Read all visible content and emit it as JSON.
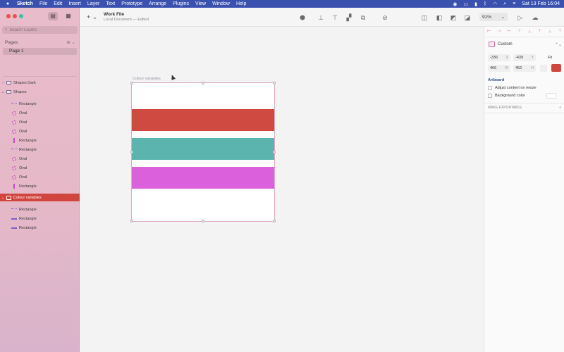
{
  "menubar": {
    "apple_icon": "apple-icon",
    "items": [
      "Sketch",
      "File",
      "Edit",
      "Insert",
      "Layer",
      "Text",
      "Prototype",
      "Arrange",
      "Plugins",
      "View",
      "Window",
      "Help"
    ],
    "datetime": "Sat 13 Feb  16:04",
    "status_icons": [
      "record-icon",
      "display-icon",
      "battery-icon",
      "bluetooth-icon",
      "wifi-icon",
      "search-icon",
      "control-center-icon"
    ]
  },
  "sidebar": {
    "search_placeholder": "Search Layers",
    "pages_label": "Pages",
    "pages": [
      {
        "label": "Page 1"
      }
    ],
    "layers": [
      {
        "label": "Shapes Dark",
        "kind": "group",
        "indent": 0
      },
      {
        "label": "Shapes",
        "kind": "group",
        "indent": 0
      },
      {
        "label": "Rectangle",
        "kind": "rect-d",
        "indent": 1
      },
      {
        "label": "Oval",
        "kind": "oval",
        "indent": 1
      },
      {
        "label": "Oval",
        "kind": "oval",
        "indent": 1
      },
      {
        "label": "Oval",
        "kind": "oval",
        "indent": 1
      },
      {
        "label": "Rectangle",
        "kind": "rect-v",
        "indent": 1
      },
      {
        "label": "Rectangle",
        "kind": "rect-d",
        "indent": 1
      },
      {
        "label": "Oval",
        "kind": "oval",
        "indent": 1
      },
      {
        "label": "Oval",
        "kind": "oval",
        "indent": 1
      },
      {
        "label": "Oval",
        "kind": "oval",
        "indent": 1
      },
      {
        "label": "Rectangle",
        "kind": "rect-v",
        "indent": 1
      },
      {
        "label": "Colour variables",
        "kind": "artboard",
        "indent": 0,
        "selected": true
      },
      {
        "label": "Rectangle",
        "kind": "rect-d",
        "indent": 1
      },
      {
        "label": "Rectangle",
        "kind": "rect-h",
        "indent": 1
      },
      {
        "label": "Rectangle",
        "kind": "rect-h",
        "indent": 1
      }
    ]
  },
  "toolbar": {
    "insert_icon": "plus-icon",
    "doc_title": "Work File",
    "doc_subtitle": "Local Document — Edited",
    "zoom": "91%",
    "icons": [
      "symbol-icon",
      "align-icon",
      "distribute-icon",
      "tidy-icon",
      "mask-icon",
      "scissors-icon",
      "union-icon",
      "subtract-icon",
      "intersect-icon",
      "difference-icon",
      "play-icon",
      "cloud-icon"
    ]
  },
  "canvas": {
    "artboard_label": "Colour variables",
    "bands": [
      {
        "name": "red",
        "color": "#cf4a40"
      },
      {
        "name": "teal",
        "color": "#5bb4ae"
      },
      {
        "name": "magenta",
        "color": "#db60dc"
      }
    ]
  },
  "inspector": {
    "preset": "Custom",
    "x": "-336",
    "x_unit": "X",
    "y": "-439",
    "y_unit": "Y",
    "fit_label": "Fit",
    "width": "466",
    "width_unit": "W",
    "height": "452",
    "height_unit": "H",
    "artboard_section": "Artboard",
    "adjust_label": "Adjust content on resize",
    "background_label": "Background color",
    "export_label": "MAKE EXPORTABLE",
    "export_add": "+",
    "accent_color": "#d0463f"
  }
}
